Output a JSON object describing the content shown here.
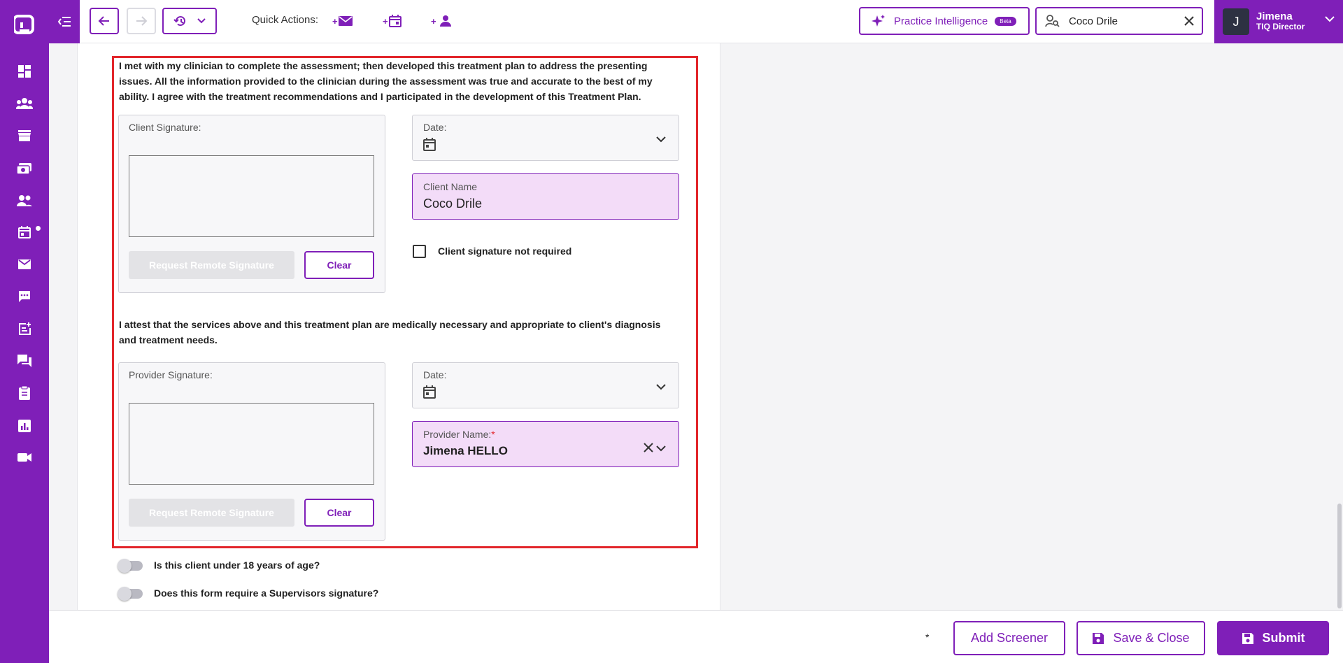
{
  "topbar": {
    "quick_actions_label": "Quick Actions:",
    "quick_actions": [
      {
        "prefix": "+",
        "icon": "envelope-icon"
      },
      {
        "prefix": "+",
        "icon": "calendar-add-icon"
      },
      {
        "prefix": "+",
        "icon": "person-add-icon"
      }
    ],
    "practice_intelligence_label": "Practice Intelligence",
    "beta_badge": "Beta",
    "client_search_value": "Coco Drile"
  },
  "user": {
    "initial": "J",
    "name": "Jimena",
    "role": "TIQ Director"
  },
  "sidebar": {
    "items": [
      "dashboard-icon",
      "clients-icon",
      "store-icon",
      "billing-icon",
      "staff-icon",
      "calendar-icon",
      "mail-icon",
      "chat-icon",
      "notes-add-icon",
      "messages-icon",
      "clipboard-icon",
      "reports-icon",
      "video-icon"
    ]
  },
  "form": {
    "client_attestation": "I met with my clinician to complete the assessment; then developed this treatment plan to address the presenting issues. All the information provided to the clinician during the assessment was true and accurate to the best of my ability. I agree with the treatment recommendations and I participated in the development of this Treatment Plan.",
    "client_signature_label": "Client Signature:",
    "request_remote_label": "Request Remote Signature",
    "clear_label": "Clear",
    "date_label": "Date:",
    "client_name_label": "Client Name",
    "client_name_value": "Coco Drile",
    "client_sig_not_required_label": "Client signature not required",
    "provider_attestation": "I attest that the services above and this treatment plan are medically necessary and appropriate to client's diagnosis and treatment needs.",
    "provider_signature_label": "Provider Signature:",
    "provider_name_label": "Provider Name:",
    "provider_name_required": "*",
    "provider_name_value": "Jimena HELLO",
    "toggle_under_18_label": "Is this client under 18 years of age?",
    "toggle_supervisor_label": "Does this form require a Supervisors signature?"
  },
  "footer": {
    "asterisk": "*",
    "add_screener_label": "Add Screener",
    "save_close_label": "Save & Close",
    "submit_label": "Submit"
  },
  "colors": {
    "brand": "#7f1fb8",
    "highlight_border": "#e2262b",
    "filled_field_bg": "#f3dcf8"
  }
}
